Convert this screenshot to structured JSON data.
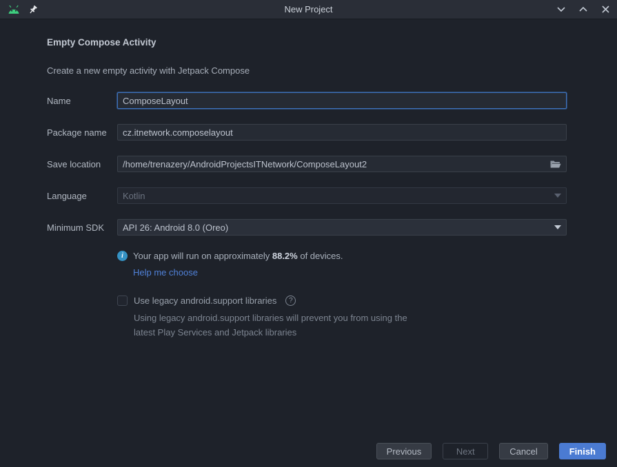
{
  "titlebar": {
    "title": "New Project",
    "icons": {
      "app": "android-robot-icon",
      "pin": "pushpin-icon",
      "minimize": "chevron-down-icon",
      "maximize": "chevron-up-icon",
      "close": "x-icon"
    }
  },
  "header": {
    "title": "Empty Compose Activity",
    "subtitle": "Create a new empty activity with Jetpack Compose"
  },
  "form": {
    "name": {
      "label": "Name",
      "value": "ComposeLayout"
    },
    "package": {
      "label": "Package name",
      "value": "cz.itnetwork.composelayout"
    },
    "save_location": {
      "label": "Save location",
      "value": "/home/trenazery/AndroidProjectsITNetwork/ComposeLayout2"
    },
    "language": {
      "label": "Language",
      "value": "Kotlin",
      "enabled": false
    },
    "min_sdk": {
      "label": "Minimum SDK",
      "value": "API 26: Android 8.0 (Oreo)",
      "enabled": true
    },
    "sdk_info": {
      "text_prefix": "Your app will run on approximately ",
      "highlight": "88.2%",
      "text_suffix": " of devices.",
      "info_glyph": "i",
      "link": "Help me choose"
    },
    "legacy": {
      "checked": false,
      "label": "Use legacy android.support libraries",
      "help_glyph": "?",
      "desc_line1": "Using legacy android.support libraries will prevent you from using the",
      "desc_line2": "latest Play Services and Jetpack libraries"
    }
  },
  "footer": {
    "previous": "Previous",
    "next": "Next",
    "cancel": "Cancel",
    "finish": "Finish",
    "next_enabled": false
  },
  "colors": {
    "titlebar_bg": "#2a2e37",
    "body_bg": "#1e222a",
    "field_bg": "#262b34",
    "field_border": "#3a4049",
    "focus_border": "#3d70b8",
    "link_blue": "#5081d8",
    "info_blue": "#3592c4",
    "finish_blue": "#4b7bd2",
    "android_green": "#3ecf7f"
  }
}
